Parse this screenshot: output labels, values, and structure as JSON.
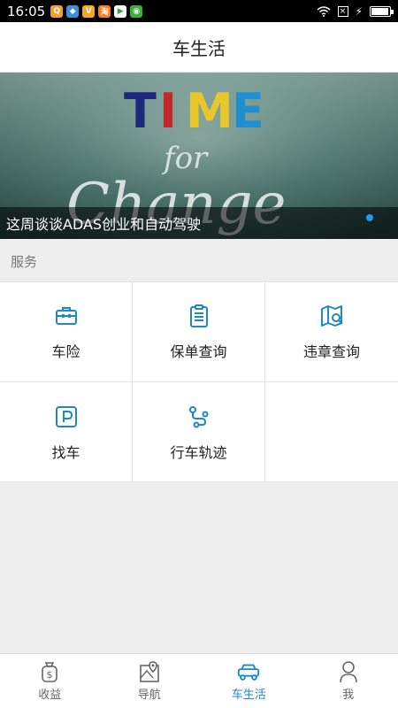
{
  "status_bar": {
    "time": "16:05",
    "apps": [
      {
        "icon": "qq-icon",
        "color": "#f0a030"
      },
      {
        "icon": "maps-icon",
        "color": "#3b8ed8"
      },
      {
        "icon": "v-app-icon",
        "color": "#f5a623"
      },
      {
        "icon": "taobao-icon",
        "color": "#ff7a1a"
      },
      {
        "icon": "play-store-icon",
        "color": "#ffffff"
      },
      {
        "icon": "wechat-icon",
        "color": "#3cb035"
      }
    ],
    "battery_level": 0.85
  },
  "header": {
    "title": "车生活"
  },
  "banner": {
    "image_text": {
      "line1": "TIME",
      "line2": "for",
      "line3": "Change"
    },
    "caption": "这周谈谈ADAS创业和自动驾驶",
    "active_dot_color": "#2196f3"
  },
  "services": {
    "section_title": "服务",
    "items": [
      {
        "label": "车险",
        "icon": "briefcase-icon"
      },
      {
        "label": "保单查询",
        "icon": "clipboard-icon"
      },
      {
        "label": "违章查询",
        "icon": "map-search-icon"
      },
      {
        "label": "找车",
        "icon": "parking-icon"
      },
      {
        "label": "行车轨迹",
        "icon": "route-icon"
      }
    ]
  },
  "bottom_nav": {
    "items": [
      {
        "label": "收益",
        "icon": "money-bag-icon",
        "active": false
      },
      {
        "label": "导航",
        "icon": "map-pin-icon",
        "active": false
      },
      {
        "label": "车生活",
        "icon": "car-icon",
        "active": true
      },
      {
        "label": "我",
        "icon": "person-icon",
        "active": false
      }
    ],
    "active_color": "#1e88c7",
    "inactive_color": "#666666"
  },
  "colors": {
    "accent": "#1e88c7",
    "background": "#eeeeee"
  }
}
